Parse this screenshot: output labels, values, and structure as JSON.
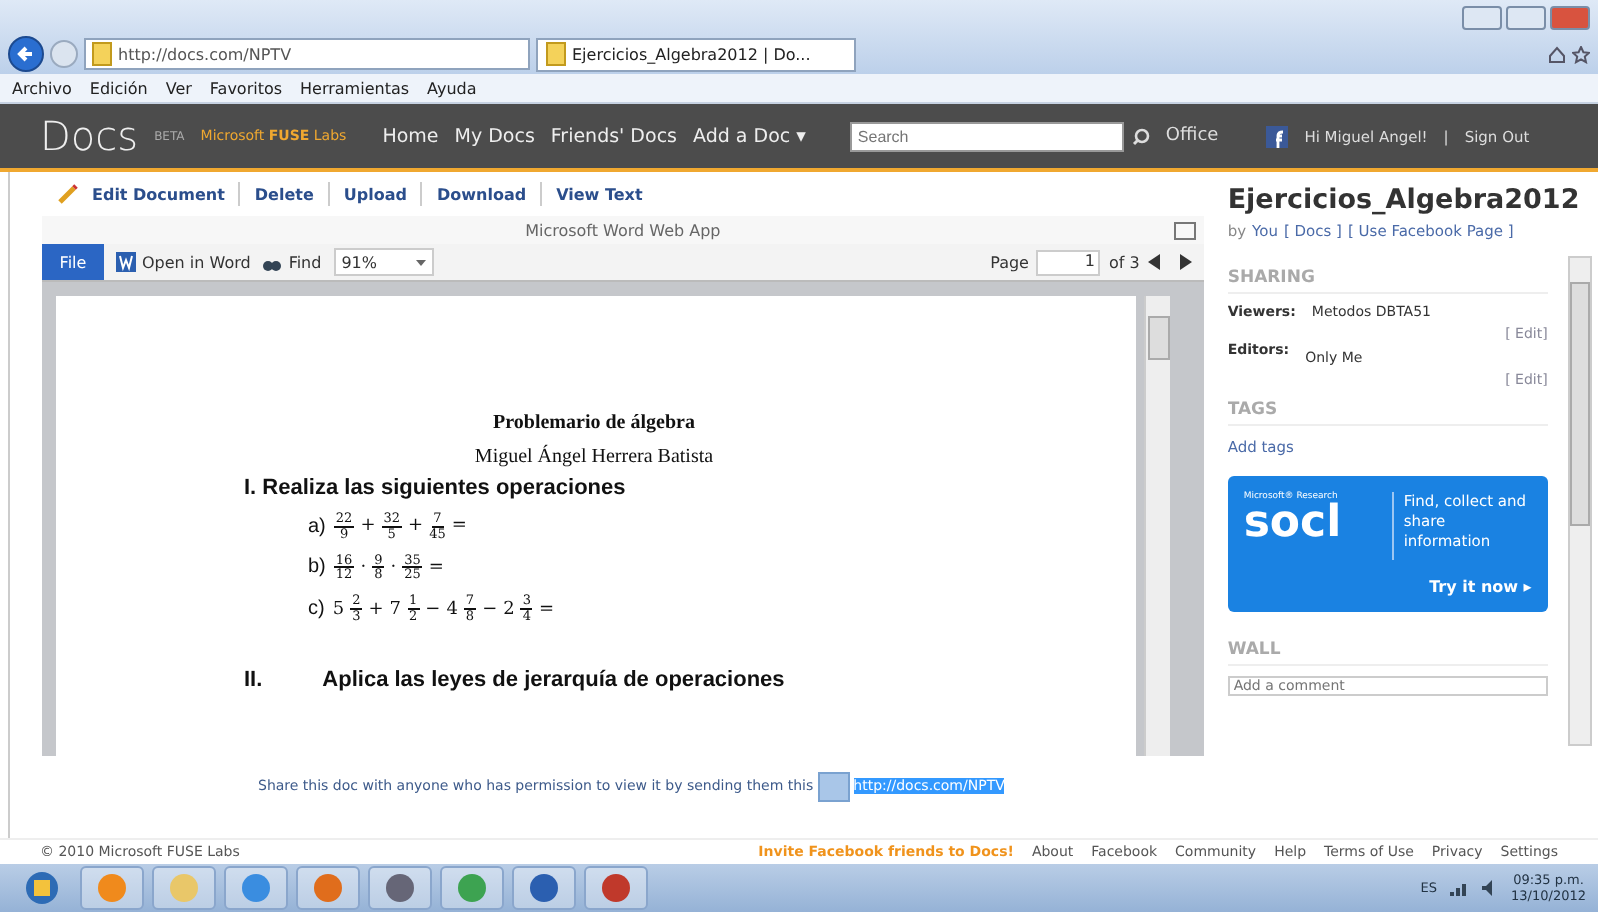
{
  "browser": {
    "address": "http://docs.com/NPTV",
    "tab": "Ejercicios_Algebra2012 | Do...",
    "menu": [
      "Archivo",
      "Edición",
      "Ver",
      "Favoritos",
      "Herramientas",
      "Ayuda"
    ]
  },
  "header": {
    "logo": "Docs",
    "beta": "BETA",
    "brand": "Microsoft **FUSE** Labs",
    "nav": [
      "Home",
      "My Docs",
      "Friends' Docs",
      "Add a Doc ▾"
    ],
    "search_placeholder": "Search",
    "office": "Office",
    "greeting": "Hi Miguel Angel!",
    "separator": "|",
    "sign_out": "Sign Out"
  },
  "doc_actions": [
    "Edit Document",
    "Delete",
    "Upload",
    "Download",
    "View Text"
  ],
  "viewer": {
    "app_title": "Microsoft Word Web App",
    "file_tab": "File",
    "open_in_word": "Open in Word",
    "find": "Find",
    "zoom": "91%",
    "page_label": "Page",
    "page": "1",
    "page_of": "of 3"
  },
  "document": {
    "title": "Problemario de álgebra",
    "author": "Miguel Ángel Herrera Batista",
    "section_1": "I. Realiza las siguientes operaciones",
    "problems": [
      {
        "label": "a)",
        "terms": [
          {
            "kind": "frac",
            "num": "22",
            "den": "9"
          },
          {
            "kind": "op",
            "text": "+"
          },
          {
            "kind": "frac",
            "num": "32",
            "den": "5"
          },
          {
            "kind": "op",
            "text": "+"
          },
          {
            "kind": "frac",
            "num": "7",
            "den": "45"
          },
          {
            "kind": "op",
            "text": "="
          }
        ]
      },
      {
        "label": "b)",
        "terms": [
          {
            "kind": "frac",
            "num": "16",
            "den": "12"
          },
          {
            "kind": "op",
            "text": "·"
          },
          {
            "kind": "frac",
            "num": "9",
            "den": "8"
          },
          {
            "kind": "op",
            "text": "·"
          },
          {
            "kind": "frac",
            "num": "35",
            "den": "25"
          },
          {
            "kind": "op",
            "text": "="
          }
        ]
      },
      {
        "label": "c)",
        "terms": [
          {
            "kind": "mixed",
            "whole": "5",
            "num": "2",
            "den": "3"
          },
          {
            "kind": "op",
            "text": "+"
          },
          {
            "kind": "mixed",
            "whole": "7",
            "num": "1",
            "den": "2"
          },
          {
            "kind": "op",
            "text": "−"
          },
          {
            "kind": "mixed",
            "whole": "4",
            "num": "7",
            "den": "8"
          },
          {
            "kind": "op",
            "text": "−"
          },
          {
            "kind": "mixed",
            "whole": "2",
            "num": "3",
            "den": "4"
          },
          {
            "kind": "op",
            "text": "="
          }
        ]
      }
    ],
    "section_2_number": "II.",
    "section_2": "Aplica las leyes de jerarquía de operaciones"
  },
  "share": {
    "text": "Share this doc with anyone who has permission to view it by sending them this",
    "link": "http://docs.com/NPTV"
  },
  "sidebar": {
    "title": "Ejercicios_Algebra2012",
    "by": "by",
    "owner": "You",
    "docs_link": "[ Docs ]",
    "facebook_link": "[ Use Facebook Page ]",
    "sharing_heading": "SHARING",
    "viewers_label": "Viewers:",
    "viewers": "Metodos DBTA51",
    "editors_label": "Editors:",
    "editors": "Only Me",
    "edit_links": [
      "[ Edit]",
      "[ Edit]"
    ],
    "tags_heading": "TAGS",
    "add_tags": "Add tags",
    "banner": {
      "research": "Microsoft® Research",
      "logo": "socl",
      "tagline": "Find, collect and share information",
      "cta": "Try it now ▸"
    },
    "wall_heading": "WALL",
    "comment_placeholder": "Add a comment"
  },
  "footer": {
    "copyright": "© 2010 Microsoft FUSE Labs",
    "invite": "Invite Facebook friends to Docs!",
    "links": [
      "About",
      "Facebook",
      "Community",
      "Help",
      "Terms of Use",
      "Privacy",
      "Settings"
    ]
  },
  "taskbar": {
    "language": "ES",
    "time": "09:35 p.m.",
    "date": "13/10/2012"
  }
}
